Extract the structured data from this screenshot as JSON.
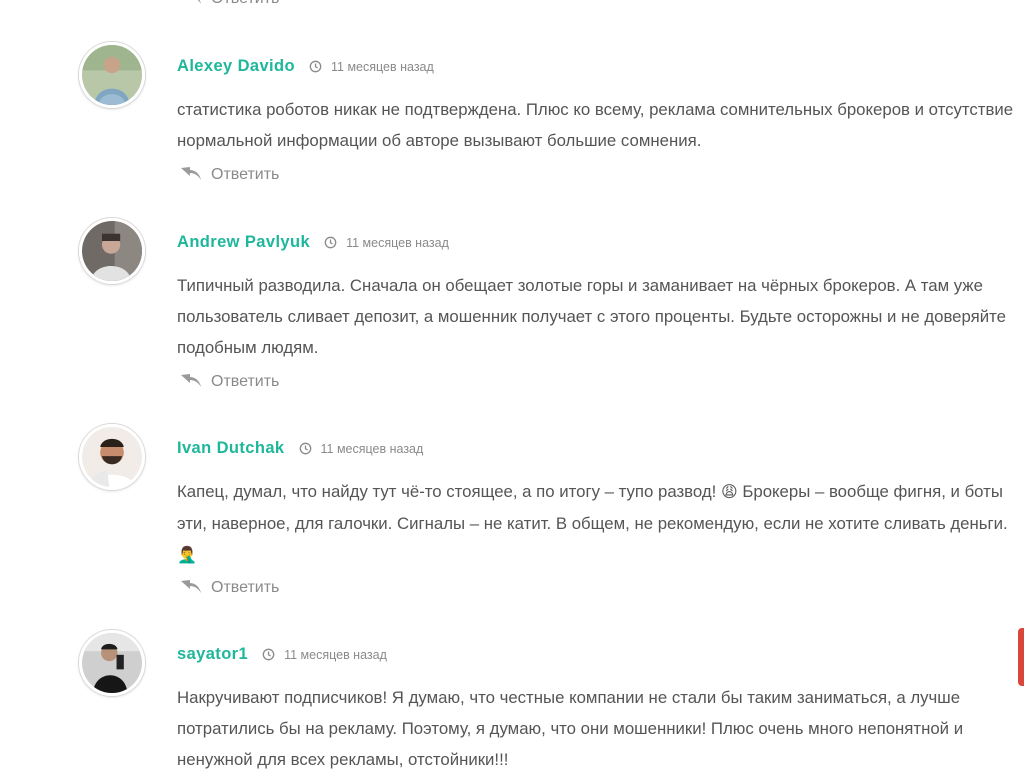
{
  "reply_label": "Ответить",
  "icons": {
    "reply": "reply-arrow-icon",
    "time": "clock-icon"
  },
  "colors": {
    "author": "#1fb79b",
    "meta": "#8a8a8a",
    "text": "#555555",
    "side_tab": "#d9463b"
  },
  "comments": [
    {
      "author": "Alexey Davido",
      "time": "11 месяцев назад",
      "text": "статистика роботов никак не подтверждена. Плюс ко всему, реклама сомнительных брокеров и отсутствие нормальной информации об авторе вызывают большие сомнения."
    },
    {
      "author": "Andrew Pavlyuk",
      "time": "11 месяцев назад",
      "text": "Типичный разводила. Сначала он обещает золотые горы и заманивает на чёрных брокеров. А там уже пользователь сливает депозит, а мошенник получает с этого проценты. Будьте осторожны и не доверяйте подобным людям."
    },
    {
      "author": "Ivan Dutchak",
      "time": "11 месяцев назад",
      "text_part1": "Капец, думал, что найду тут чё-то стоящее, а по итогу – тупо развод!",
      "emoji1": "😩",
      "text_part2": "Брокеры – вообще фигня, и боты эти, наверное, для галочки. Сигналы – не катит. В общем, не рекомендую, если не хотите сливать деньги.",
      "emoji2": "🤦‍♂️"
    },
    {
      "author": "sayator1",
      "time": "11 месяцев назад",
      "text": "Накручивают подписчиков! Я думаю, что честные компании не стали бы таким заниматься, а лучше потратились бы на рекламу. Поэтому, я думаю, что они мошенники! Плюс очень много непонятной и ненужной для всех рекламы, отстойники!!!"
    }
  ]
}
